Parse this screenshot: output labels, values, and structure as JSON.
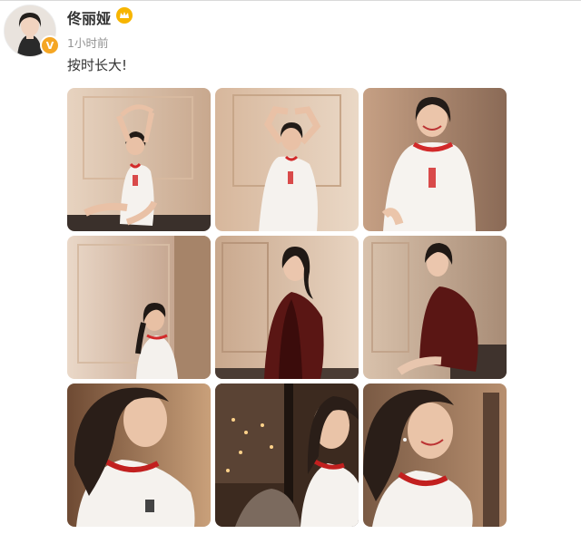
{
  "post": {
    "username": "佟丽娅",
    "timestamp": "1小时前",
    "text": "按时长大!",
    "verified_badge": "V",
    "member_icon": "crown-icon",
    "avatar_icon": "user-avatar"
  },
  "colors": {
    "username": "#333333",
    "timestamp": "#939393",
    "verified": "#f5a623",
    "member": "#f7b500"
  },
  "photos": [
    {
      "name": "photo-1",
      "scene": "woman-white-tshirt-arms-raised-sitting"
    },
    {
      "name": "photo-2",
      "scene": "woman-white-tshirt-hands-on-head"
    },
    {
      "name": "photo-3",
      "scene": "woman-white-tshirt-smiling"
    },
    {
      "name": "photo-4",
      "scene": "woman-white-tshirt-seated-curtain"
    },
    {
      "name": "photo-5",
      "scene": "woman-dark-red-jacket-standing"
    },
    {
      "name": "photo-6",
      "scene": "woman-dark-red-jacket-sitting"
    },
    {
      "name": "photo-7",
      "scene": "closeup-profile-white-tshirt"
    },
    {
      "name": "photo-8",
      "scene": "closeup-city-lights-window"
    },
    {
      "name": "photo-9",
      "scene": "closeup-smiling-profile"
    }
  ]
}
